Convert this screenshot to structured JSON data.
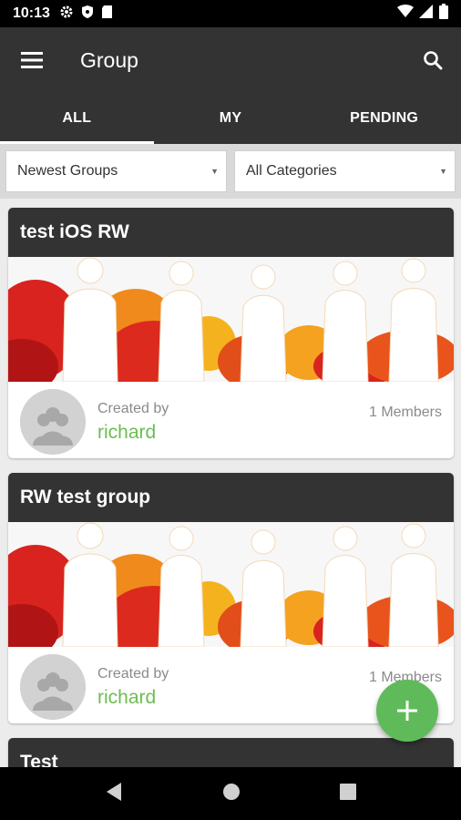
{
  "status_bar": {
    "time": "10:13",
    "left_icons": [
      "settings-icon",
      "shield-icon",
      "sd-card-icon"
    ],
    "right_icons": [
      "wifi-icon",
      "signal-icon",
      "battery-icon"
    ]
  },
  "app_bar": {
    "title": "Group",
    "menu_icon": "hamburger-menu-icon",
    "search_icon": "search-icon"
  },
  "tabs": [
    {
      "label": "ALL",
      "active": true
    },
    {
      "label": "MY",
      "active": false
    },
    {
      "label": "PENDING",
      "active": false
    }
  ],
  "filters": {
    "sort": "Newest Groups",
    "category": "All Categories"
  },
  "groups": [
    {
      "name": "test iOS RW",
      "created_label": "Created by",
      "creator": "richard",
      "members": "1 Members"
    },
    {
      "name": "RW test group",
      "created_label": "Created by",
      "creator": "richard",
      "members": "1 Members"
    },
    {
      "name": "Test"
    }
  ],
  "fab": {
    "icon": "plus-icon"
  },
  "nav_bar": {
    "icons": [
      "back-icon",
      "home-icon",
      "recents-icon"
    ]
  },
  "colors": {
    "header": "#333333",
    "accent_green": "#6cbd52",
    "fab_green": "#5fbb5a",
    "background": "#ececec"
  }
}
